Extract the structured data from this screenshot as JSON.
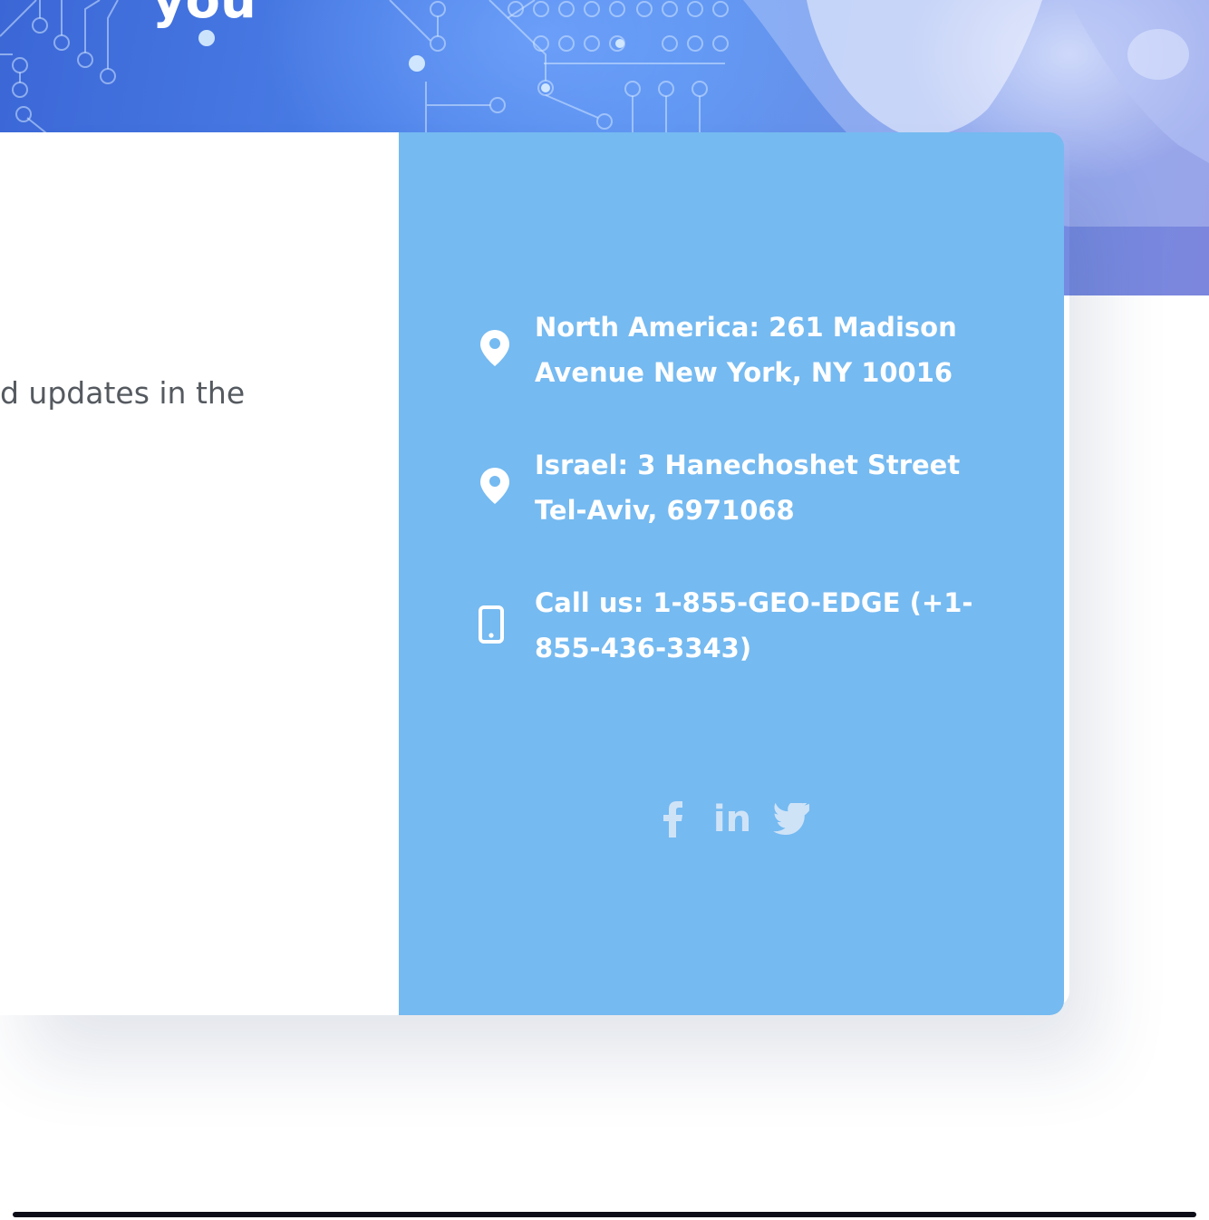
{
  "hero": {
    "title_fragment": "you"
  },
  "intro": {
    "text_fragment": "d updates in the"
  },
  "contact": {
    "items": [
      {
        "icon": "map-pin-icon",
        "line1": "North America: 261 Madison",
        "line2": "Avenue New York, NY 10016"
      },
      {
        "icon": "map-pin-icon",
        "line1": "Israel: 3 Hanechoshet Street",
        "line2": "Tel-Aviv, 6971068"
      },
      {
        "icon": "mobile-phone-icon",
        "line1": "Call us: 1-855-GEO-EDGE (+1-",
        "line2": "855-436-3343)"
      }
    ],
    "social": [
      {
        "icon": "facebook-icon"
      },
      {
        "icon": "linkedin-icon",
        "label": "in"
      },
      {
        "icon": "twitter-icon"
      }
    ]
  },
  "colors": {
    "panel": "#75baf1",
    "text_on_panel": "#ffffff",
    "body_text": "#555a60",
    "social_icon": "#cfe3f7"
  }
}
